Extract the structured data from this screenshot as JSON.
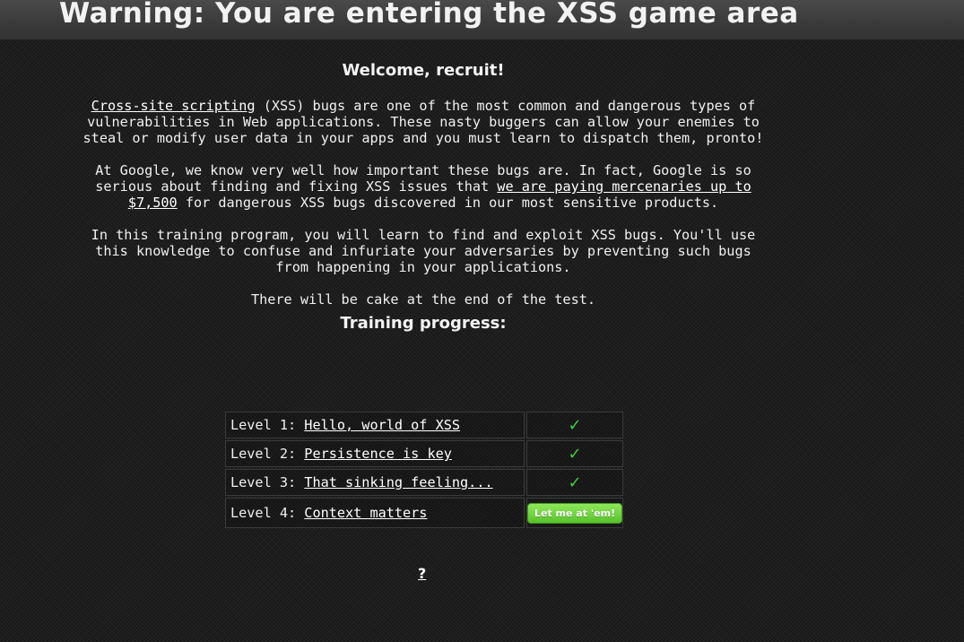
{
  "header": {
    "title": "Warning: You are entering the XSS game area"
  },
  "intro": {
    "heading": "Welcome, recruit!",
    "p1_link": "Cross-site scripting",
    "p1_rest": " (XSS) bugs are one of the most common and dangerous types of vulnerabilities in Web applications. These nasty buggers can allow your enemies to steal or modify user data in your apps and you must learn to dispatch them, pronto!",
    "p2_start": "At Google, we know very well how important these bugs are. In fact, Google is so serious about finding and fixing XSS issues that ",
    "p2_link": "we are paying mercenaries up to $7,500",
    "p2_end": " for dangerous XSS bugs discovered in our most sensitive products.",
    "p3": "In this training program, you will learn to find and exploit XSS bugs. You'll use this knowledge to confuse and infuriate your adversaries by preventing such bugs from happening in your applications.",
    "p4": "There will be cake at the end of the test."
  },
  "progress": {
    "heading": "Training progress:",
    "levels": [
      {
        "prefix": "Level 1: ",
        "name": "Hello, world of XSS",
        "status": "✓"
      },
      {
        "prefix": "Level 2: ",
        "name": "Persistence is key",
        "status": "✓"
      },
      {
        "prefix": "Level 3: ",
        "name": "That sinking feeling...",
        "status": "✓"
      },
      {
        "prefix": "Level 4: ",
        "name": "Context matters",
        "button": "Let me at 'em!"
      }
    ]
  },
  "footer": {
    "help": "?"
  },
  "colors": {
    "background": "#1d1d1d",
    "check": "#3ccf3c",
    "button": "#6ad43a"
  }
}
